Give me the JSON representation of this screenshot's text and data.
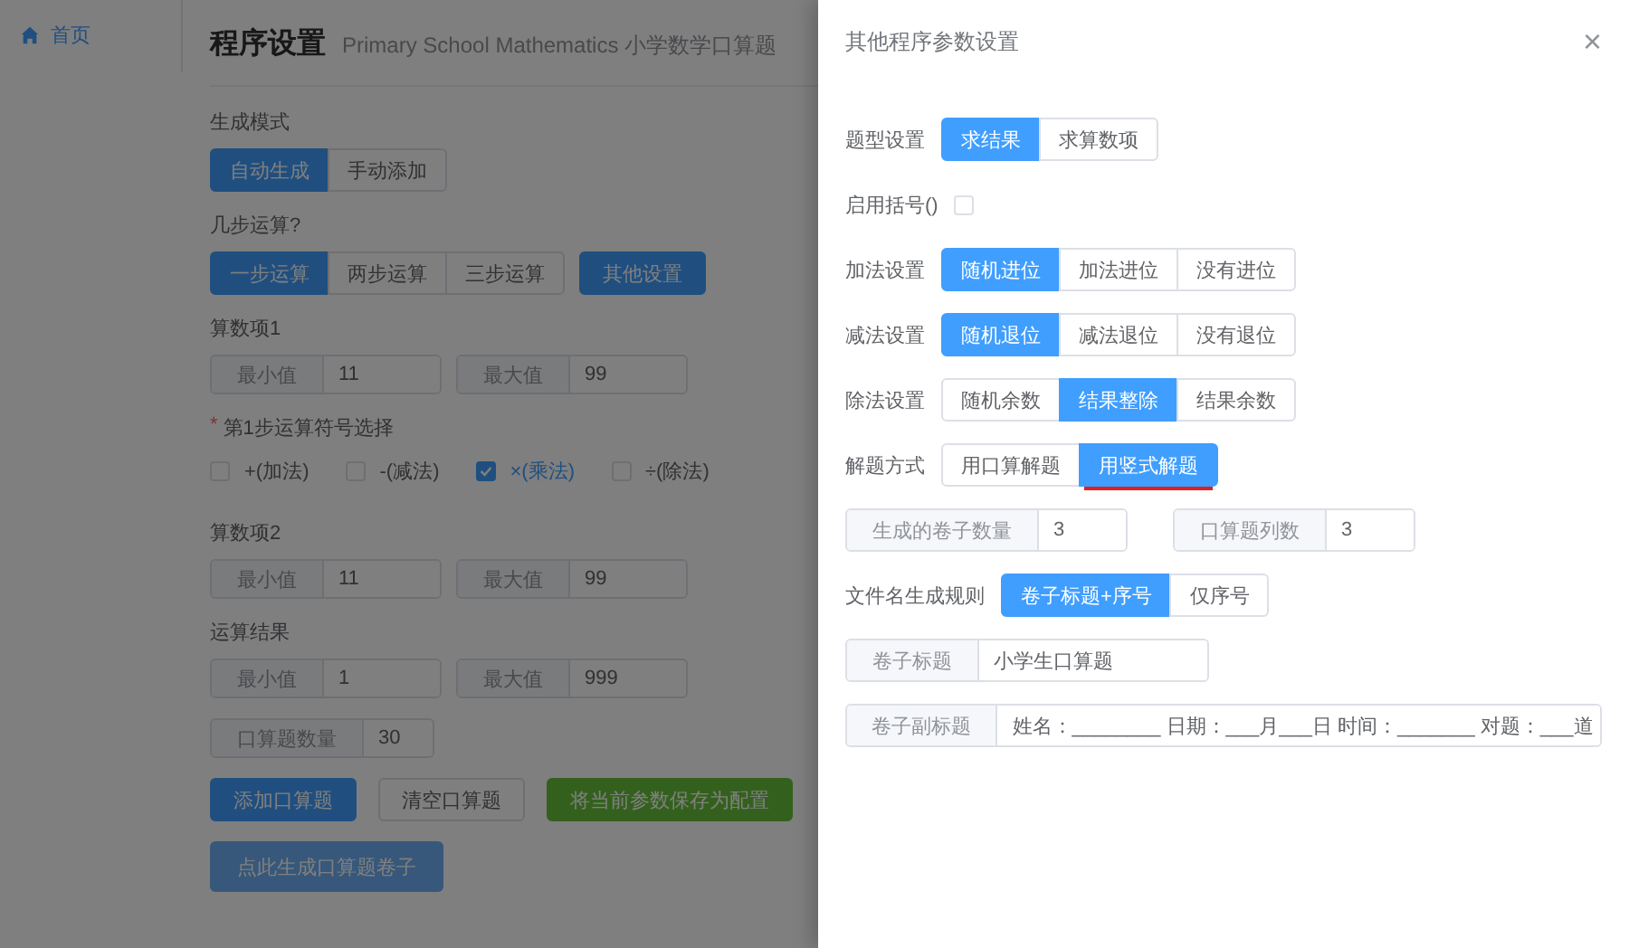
{
  "sidebar": {
    "items": [
      {
        "label": "首页",
        "selected": true
      }
    ]
  },
  "page": {
    "title": "程序设置",
    "subtitle": "Primary School Mathematics 小学数学口算题"
  },
  "form": [
    {
      "kind": "group",
      "label": "生成模式",
      "options": [
        {
          "label": "自动生成",
          "selected": true
        },
        {
          "label": "手动添加",
          "selected": false
        }
      ]
    },
    {
      "kind": "group",
      "label": "几步运算?",
      "options": [
        {
          "label": "一步运算",
          "selected": true
        },
        {
          "label": "两步运算",
          "selected": false
        },
        {
          "label": "三步运算",
          "selected": false
        }
      ],
      "extra_button": "其他设置"
    },
    {
      "kind": "range",
      "label": "算数项1",
      "fields": [
        {
          "label": "最小值",
          "value": "11"
        },
        {
          "label": "最大值",
          "value": "99"
        }
      ]
    },
    {
      "kind": "checks",
      "label": "第1步运算符号选择",
      "required_mark": "*",
      "options": [
        {
          "label": "+(加法)",
          "checked": false
        },
        {
          "label": "-(减法)",
          "checked": false
        },
        {
          "label": "×(乘法)",
          "checked": true
        },
        {
          "label": "÷(除法)",
          "checked": false
        }
      ]
    },
    {
      "kind": "range",
      "label": "算数项2",
      "fields": [
        {
          "label": "最小值",
          "value": "11"
        },
        {
          "label": "最大值",
          "value": "99"
        }
      ]
    },
    {
      "kind": "range",
      "label": "运算结果",
      "fields": [
        {
          "label": "最小值",
          "value": "1"
        },
        {
          "label": "最大值",
          "value": "999"
        }
      ]
    },
    {
      "kind": "range",
      "fields": [
        {
          "label": "口算题数量",
          "value": "30"
        }
      ]
    },
    {
      "kind": "buttons",
      "buttons": [
        {
          "label": "添加口算题",
          "kind": "primary",
          "disabled": false
        },
        {
          "label": "清空口算题",
          "kind": "default",
          "disabled": false
        },
        {
          "label": "将当前参数保存为配置",
          "kind": "success",
          "disabled": false
        }
      ]
    },
    {
      "kind": "buttons",
      "buttons": [
        {
          "label": "点此生成口算题卷子",
          "kind": "primary",
          "disabled": true
        }
      ]
    }
  ],
  "drawer": {
    "title": "其他程序参数设置",
    "close": "×",
    "rows": [
      {
        "kind": "group",
        "label": "题型设置",
        "options": [
          {
            "label": "求结果",
            "selected": true,
            "underlined": false
          },
          {
            "label": "求算数项",
            "selected": false,
            "underlined": false
          }
        ]
      },
      {
        "kind": "checkbox",
        "label": "启用括号()",
        "checked": false
      },
      {
        "kind": "group",
        "label": "加法设置",
        "options": [
          {
            "label": "随机进位",
            "selected": true,
            "underlined": false
          },
          {
            "label": "加法进位",
            "selected": false,
            "underlined": false
          },
          {
            "label": "没有进位",
            "selected": false,
            "underlined": false
          }
        ]
      },
      {
        "kind": "group",
        "label": "减法设置",
        "options": [
          {
            "label": "随机退位",
            "selected": true,
            "underlined": false
          },
          {
            "label": "减法退位",
            "selected": false,
            "underlined": false
          },
          {
            "label": "没有退位",
            "selected": false,
            "underlined": false
          }
        ]
      },
      {
        "kind": "group",
        "label": "除法设置",
        "options": [
          {
            "label": "随机余数",
            "selected": false,
            "underlined": false
          },
          {
            "label": "结果整除",
            "selected": true,
            "underlined": false
          },
          {
            "label": "结果余数",
            "selected": false,
            "underlined": false
          }
        ]
      },
      {
        "kind": "group",
        "label": "解题方式",
        "options": [
          {
            "label": "用口算解题",
            "selected": false,
            "underlined": false
          },
          {
            "label": "用竖式解题",
            "selected": true,
            "underlined": true
          }
        ]
      },
      {
        "kind": "inputs",
        "fields": [
          {
            "label": "生成的卷子数量",
            "value": "3"
          },
          {
            "label": "口算题列数",
            "value": "3"
          }
        ]
      },
      {
        "kind": "group",
        "label": "文件名生成规则",
        "options": [
          {
            "label": "卷子标题+序号",
            "selected": true,
            "underlined": false
          },
          {
            "label": "仅序号",
            "selected": false,
            "underlined": false
          }
        ]
      },
      {
        "kind": "wide",
        "fields": [
          {
            "label": "卷子标题",
            "value": "小学生口算题"
          }
        ]
      },
      {
        "kind": "wide",
        "fields": [
          {
            "label": "卷子副标题",
            "value": "姓名：________ 日期：___月___日 时间：_______ 对题：___道"
          }
        ]
      }
    ]
  }
}
